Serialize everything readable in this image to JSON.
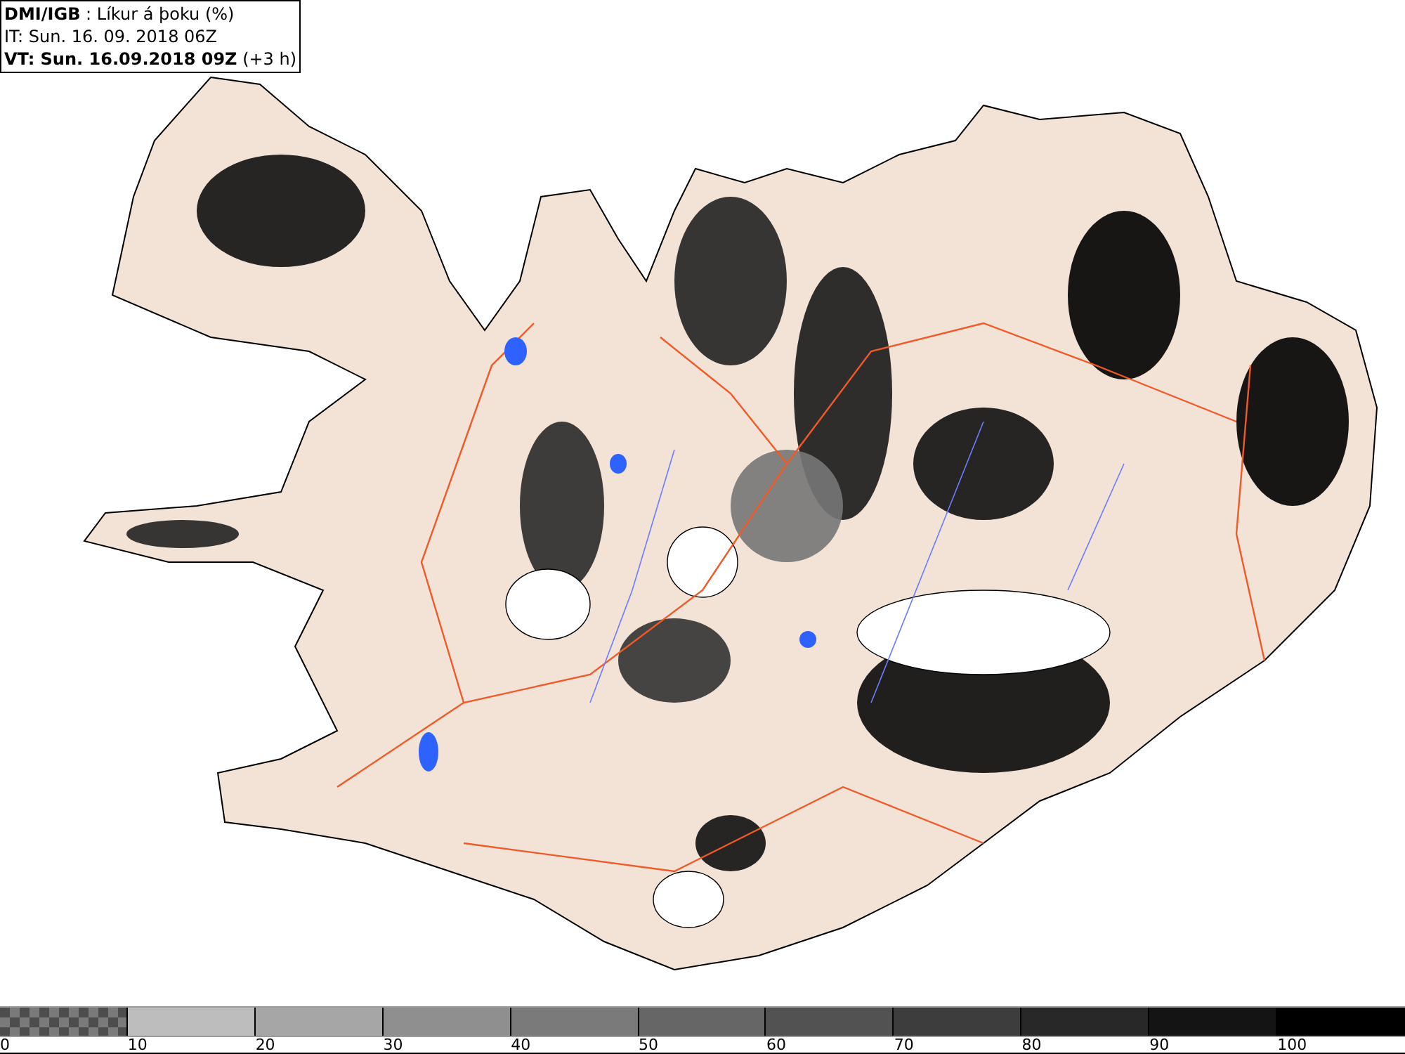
{
  "header": {
    "lines": [
      "**DMI/IGB** : Líkur á þoku (%)",
      "IT: Sun. 16. 09. 2018 06Z",
      "**VT: Sun. 16.09.2018 09Z** (+3 h)"
    ]
  },
  "legend": {
    "bins": [
      {
        "kind": "pattern",
        "color": "#4d4d4d"
      },
      {
        "kind": "solid",
        "color": "#bdbdbd"
      },
      {
        "kind": "solid",
        "color": "#a6a6a6"
      },
      {
        "kind": "solid",
        "color": "#8f8f8f"
      },
      {
        "kind": "solid",
        "color": "#7a7a7a"
      },
      {
        "kind": "solid",
        "color": "#666666"
      },
      {
        "kind": "solid",
        "color": "#525252"
      },
      {
        "kind": "solid",
        "color": "#3d3d3d"
      },
      {
        "kind": "solid",
        "color": "#282828"
      },
      {
        "kind": "solid",
        "color": "#141414"
      },
      {
        "kind": "solid",
        "color": "#000000"
      }
    ],
    "ticks": [
      "0",
      "10",
      "20",
      "30",
      "40",
      "50",
      "60",
      "70",
      "80",
      "90",
      "100"
    ]
  }
}
